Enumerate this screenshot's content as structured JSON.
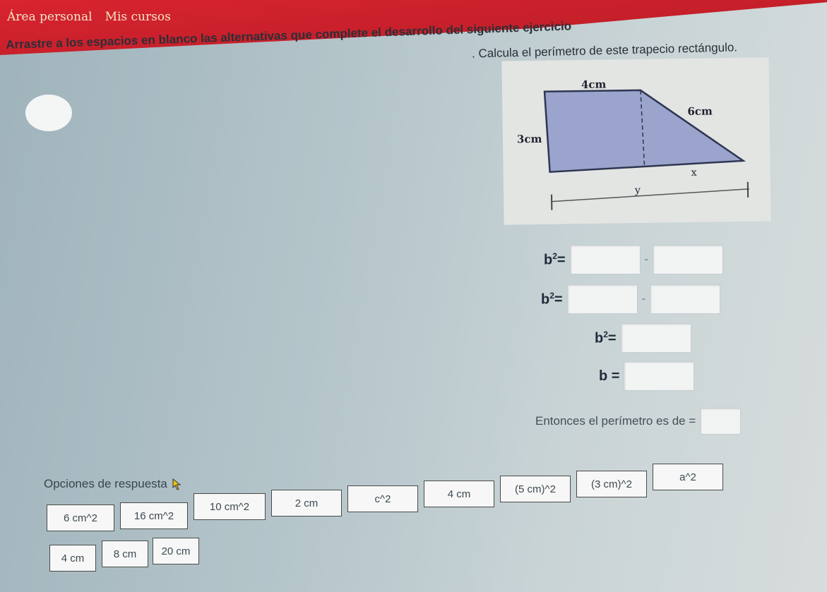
{
  "nav": {
    "item1": "Área personal",
    "item2": "Mis cursos"
  },
  "instruction": "Arrastre a los espacios en blanco las alternativas que complete el desarrollo del siguiente ejercicio",
  "question": ". Calcula el perímetro de este trapecio rectángulo.",
  "figure": {
    "top_label": "4cm",
    "slant_label": "6cm",
    "left_label": "3cm",
    "x_label": "x",
    "y_label": "y"
  },
  "equations": [
    {
      "label": "b",
      "exp": "2",
      "op": "=",
      "sep": "-"
    },
    {
      "label": "b",
      "exp": "2",
      "op": "=",
      "sep": "-"
    },
    {
      "label": "b",
      "exp": "2",
      "op": "="
    },
    {
      "label": "b",
      "op": "="
    }
  ],
  "perimeter_text": "Entonces el perímetro es de =",
  "options_title": "Opciones de respuesta",
  "options": [
    "6 cm^2",
    "16 cm^2",
    "10 cm^2",
    "2 cm",
    "c^2",
    "4 cm",
    "(5 cm)^2",
    "(3 cm)^2",
    "a^2",
    "4 cm",
    "8 cm",
    "20 cm"
  ],
  "colors": {
    "header_red": "#c41f2a",
    "shape_fill": "#9aa4cc",
    "shape_stroke": "#2f3652"
  }
}
